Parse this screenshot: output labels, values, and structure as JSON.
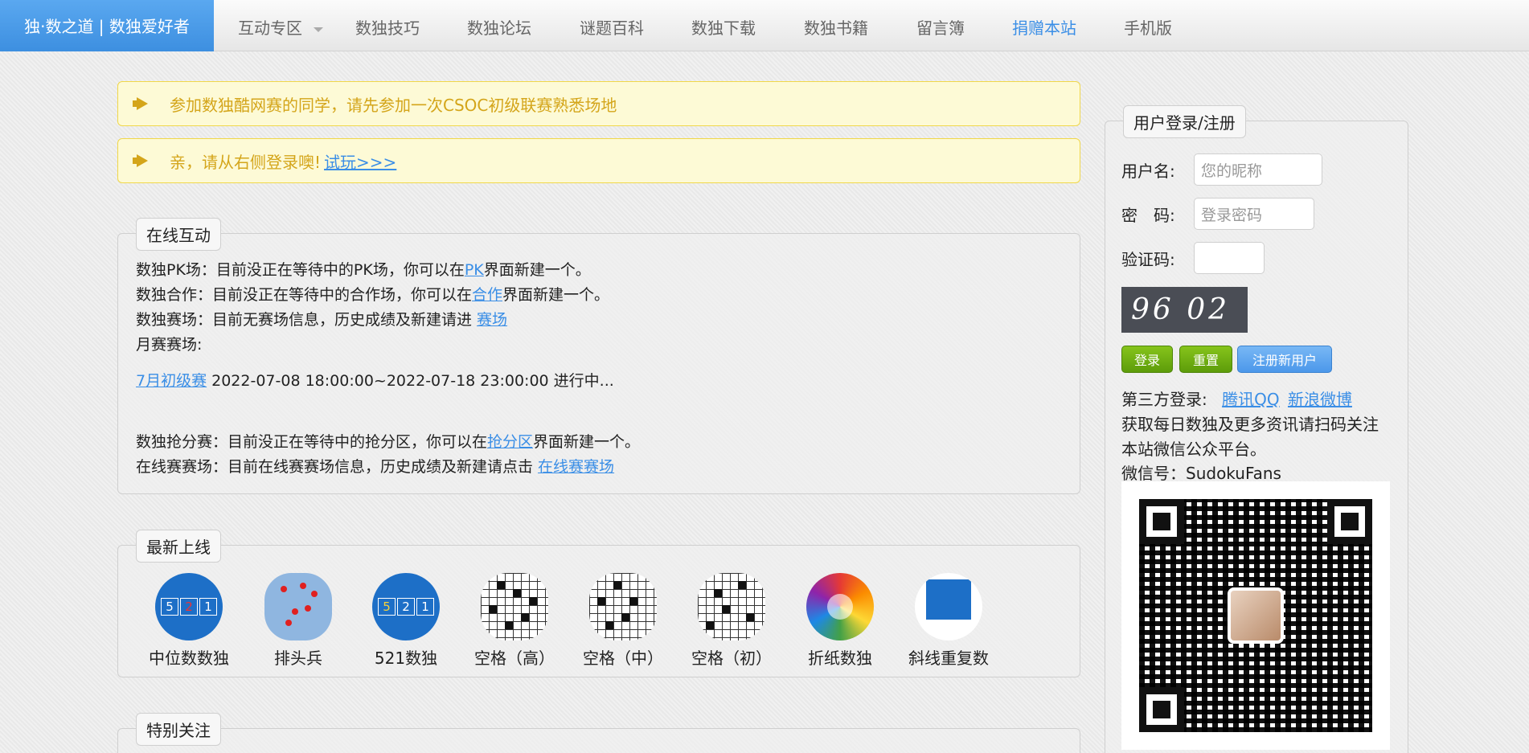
{
  "nav": {
    "brand": "独·数之道 | 数独爱好者",
    "items": [
      "互动专区",
      "数独技巧",
      "数独论坛",
      "谜题百科",
      "数独下载",
      "数独书籍",
      "留言簿",
      "捐赠本站",
      "手机版"
    ]
  },
  "notices": {
    "first": "参加数独酷网赛的同学，请先参加一次CSOC初级联赛熟悉场地",
    "second_text": "亲，请从右侧登录噢!",
    "second_link": "试玩>>>"
  },
  "online": {
    "legend": "在线互动",
    "pk_pre": "数独PK场：目前没正在等待中的PK场，你可以在",
    "pk_link": "PK",
    "pk_post": "界面新建一个。",
    "coop_pre": "数独合作：目前没正在等待中的合作场，你可以在",
    "coop_link": "合作",
    "coop_post": "界面新建一个。",
    "arena_pre": "数独赛场：目前无赛场信息，历史成绩及新建请进 ",
    "arena_link": "赛场",
    "monthly_label": "月赛赛场:",
    "monthly_link": "7月初级赛",
    "monthly_time": " 2022-07-08 18:00:00~2022-07-18 23:00:00 进行中...",
    "grab_pre": "数独抢分赛：目前没正在等待中的抢分区，你可以在",
    "grab_link": "抢分区",
    "grab_post": "界面新建一个。",
    "online_pre": "在线赛赛场：目前在线赛赛场信息，历史成绩及新建请点击 ",
    "online_link": "在线赛赛场"
  },
  "latest": {
    "legend": "最新上线",
    "games": [
      "中位数数独",
      "排头兵",
      "521数独",
      "空格（高）",
      "空格（中）",
      "空格（初）",
      "折纸数独",
      "斜线重复数"
    ],
    "median_digits": [
      "5",
      "2",
      "1"
    ],
    "five21_digits": [
      "5",
      "2",
      "1"
    ]
  },
  "special": {
    "legend": "特别关注"
  },
  "login": {
    "legend": "用户登录/注册",
    "username_label": "用户名:",
    "username_placeholder": "您的昵称",
    "password_label": "密　码:",
    "password_placeholder": "登录密码",
    "captcha_label": "验证码:",
    "captcha_text": "96 02",
    "login_btn": "登录",
    "reset_btn": "重置",
    "register_btn": "注册新用户",
    "third_party_label": "第三方登录:",
    "qq_link": "腾讯QQ",
    "weibo_link": "新浪微博",
    "info1": "获取每日数独及更多资讯请扫码关注",
    "info2": "本站微信公众平台。",
    "wechat": "微信号：SudokuFans"
  },
  "colors": {
    "brand": "#3d8fe0",
    "link": "#3a8ee6",
    "notice_bg": "#fdfad6",
    "notice_text": "#d4a51a",
    "green_btn": "#6aab0f"
  }
}
